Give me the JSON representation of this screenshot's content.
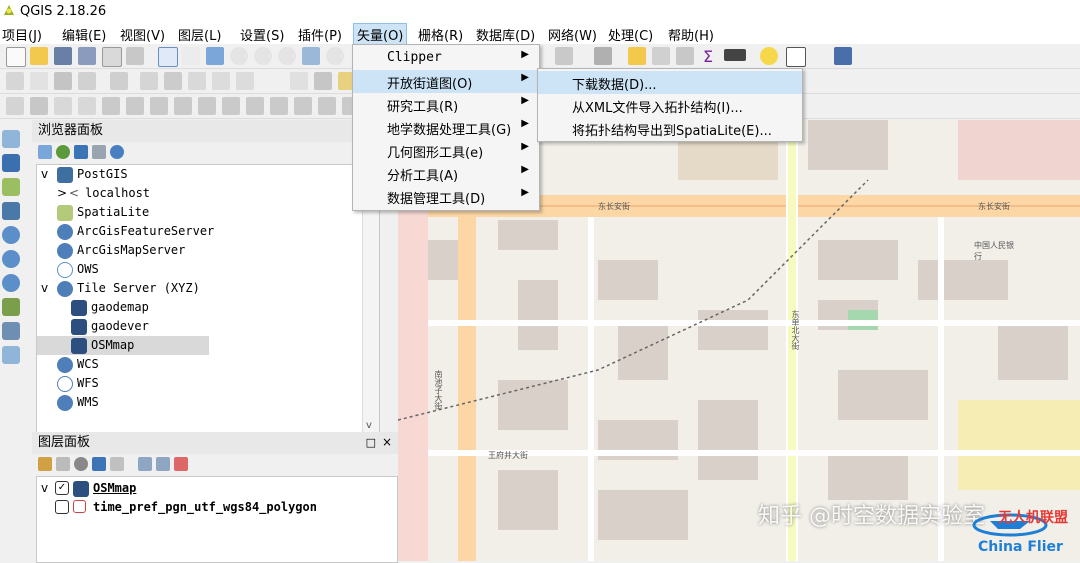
{
  "window": {
    "title": "QGIS 2.18.26"
  },
  "menubar": {
    "items": [
      "项目(J)",
      "编辑(E)",
      "视图(V)",
      "图层(L)",
      "设置(S)",
      "插件(P)",
      "矢量(O)",
      "栅格(R)",
      "数据库(D)",
      "网络(W)",
      "处理(C)",
      "帮助(H)"
    ],
    "active": "矢量(O)"
  },
  "vector_menu": {
    "items": [
      {
        "label": "Clipper"
      },
      {
        "label": "开放街道图(O)"
      },
      {
        "label": "研究工具(R)"
      },
      {
        "label": "地学数据处理工具(G)"
      },
      {
        "label": "几何图形工具(e)"
      },
      {
        "label": "分析工具(A)"
      },
      {
        "label": "数据管理工具(D)"
      }
    ],
    "highlighted": "开放街道图(O)"
  },
  "osm_submenu": {
    "items": [
      {
        "label": "下载数据(D)..."
      },
      {
        "label": "从XML文件导入拓扑结构(I)..."
      },
      {
        "label": "将拓扑结构导出到SpatiaLite(E)..."
      }
    ],
    "highlighted": "下载数据(D)..."
  },
  "browser_panel": {
    "title": "浏览器面板",
    "items": [
      {
        "label": "PostGIS",
        "expanded": "v",
        "icon": "postgis-icon"
      },
      {
        "label": "localhost",
        "expanded": ">",
        "icon": "connection-icon"
      },
      {
        "label": "SpatiaLite",
        "expanded": "",
        "icon": "spatialite-icon"
      },
      {
        "label": "ArcGisFeatureServer",
        "expanded": "",
        "icon": "arcgis-feature-icon"
      },
      {
        "label": "ArcGisMapServer",
        "expanded": "",
        "icon": "arcgis-map-icon"
      },
      {
        "label": "OWS",
        "expanded": "",
        "icon": "ows-icon"
      },
      {
        "label": "Tile Server (XYZ)",
        "expanded": "v",
        "icon": "xyz-icon"
      },
      {
        "label": "gaodemap",
        "expanded": "",
        "icon": "tile-icon"
      },
      {
        "label": "gaodever",
        "expanded": "",
        "icon": "tile-icon"
      },
      {
        "label": "OSMmap",
        "expanded": "",
        "icon": "tile-icon"
      },
      {
        "label": "WCS",
        "expanded": "",
        "icon": "wcs-icon"
      },
      {
        "label": "WFS",
        "expanded": "",
        "icon": "wfs-icon"
      },
      {
        "label": "WMS",
        "expanded": "",
        "icon": "wms-icon"
      }
    ],
    "selected": "OSMmap"
  },
  "layers_panel": {
    "title": "图层面板",
    "layers": [
      {
        "name": "OSMmap",
        "checked": true
      },
      {
        "name": "time_pref_pgn_utf_wgs84_polygon",
        "checked": false
      }
    ]
  },
  "watermark": {
    "text": "知乎 @时空数据实验室",
    "brand_cn": "无人机联盟",
    "brand_en": "China Flier"
  },
  "map_labels": [
    "东长安街",
    "东长安街",
    "王府井大街",
    "东单北大街",
    "中国人民银行",
    "南池子大街"
  ]
}
